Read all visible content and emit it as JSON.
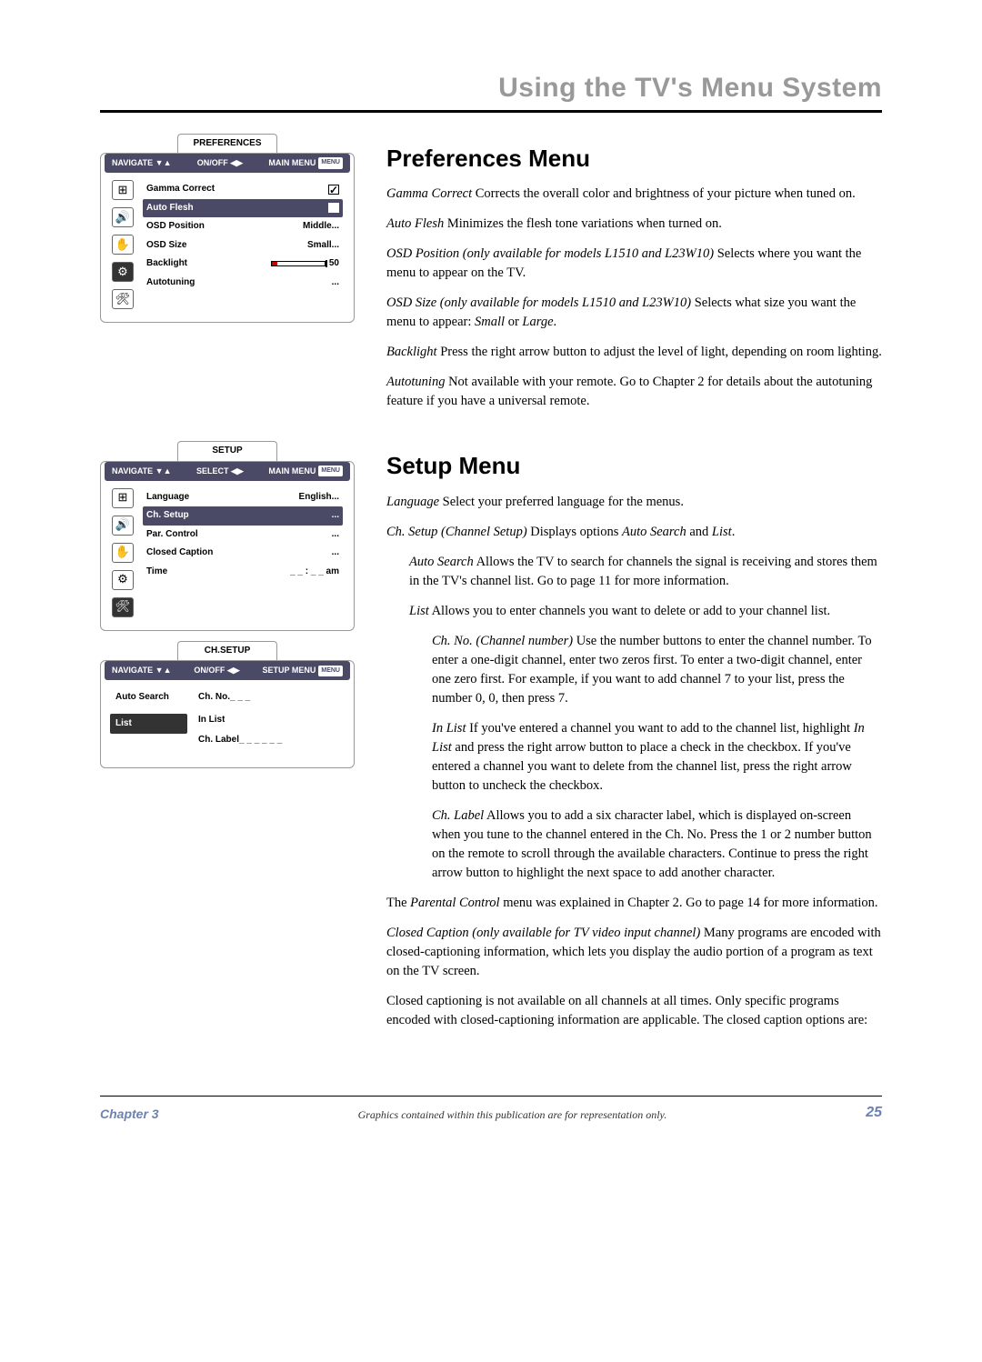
{
  "section_title": "Using the TV's Menu System",
  "preferences_menu": {
    "title_tab": "PREFERENCES",
    "nav_navigate": "NAVIGATE ▼▲",
    "nav_onoff": "ON/OFF ◀▶",
    "nav_main": "MAIN MENU",
    "nav_badge": "MENU",
    "items": [
      {
        "label": "Gamma Correct",
        "value_type": "check",
        "hl": false
      },
      {
        "label": "Auto Flesh",
        "value_type": "check_hl",
        "hl": true
      },
      {
        "label": "OSD Position",
        "value": "Middle...",
        "hl": false
      },
      {
        "label": "OSD Size",
        "value": "Small...",
        "hl": false
      },
      {
        "label": "Backlight",
        "value_type": "slider",
        "slider_val": "50",
        "hl": false
      },
      {
        "label": "Autotuning",
        "value": "...",
        "hl": false
      }
    ]
  },
  "setup_menu": {
    "title_tab": "SETUP",
    "nav_navigate": "NAVIGATE ▼▲",
    "nav_select": "SELECT ◀▶",
    "nav_main": "MAIN MENU",
    "nav_badge": "MENU",
    "items": [
      {
        "label": "Language",
        "value": "English...",
        "hl": false
      },
      {
        "label": "Ch. Setup",
        "value": "...",
        "hl": true
      },
      {
        "label": "Par. Control",
        "value": "...",
        "hl": false
      },
      {
        "label": "Closed Caption",
        "value": "...",
        "hl": false
      },
      {
        "label": "Time",
        "value": "_ _ : _ _ am",
        "hl": false
      }
    ]
  },
  "chsetup_menu": {
    "title_tab": "CH.SETUP",
    "nav_navigate": "NAVIGATE ▼▲",
    "nav_onoff": "ON/OFF ◀▶",
    "nav_setup": "SETUP MENU",
    "nav_badge": "MENU",
    "left_items": [
      {
        "label": "Auto Search",
        "hl": false
      },
      {
        "label": "List",
        "hl": true
      }
    ],
    "right_items": [
      {
        "label": "Ch. No.",
        "value": "_ _ _",
        "hl": false
      },
      {
        "label": "In List",
        "value_type": "check_hl",
        "hl": true
      },
      {
        "label": "Ch. Label",
        "value": "_ _ _ _ _ _",
        "hl": false
      }
    ]
  },
  "text": {
    "prefs_h": "Preferences Menu",
    "gamma_l": "Gamma Correct",
    "gamma_t": "   Corrects the overall color and brightness of your picture when tuned on.",
    "aflesh_l": "Auto Flesh",
    "aflesh_t": "   Minimizes the flesh tone variations when turned on.",
    "osdpos_l": "OSD Position (only available for models L1510 and L23W10)",
    "osdpos_t": "   Selects where you want the menu to appear on the TV.",
    "osdsize_l": "OSD Size (only available for models L1510 and L23W10)",
    "osdsize_t": "   Selects what size you want the menu to appear: ",
    "osdsize_s": "Small",
    "osdsize_or": " or ",
    "osdsize_lg": "Large",
    "osdsize_dot": ".",
    "backl_l": "Backlight",
    "backl_t": "   Press the right arrow button to adjust the level of light, depending on room lighting.",
    "autot_l": "Autotuning",
    "autot_t": "   Not available with your remote. Go to Chapter 2 for details about the autotuning feature if you have a universal remote.",
    "setup_h": "Setup Menu",
    "lang_l": "Language",
    "lang_t": "   Select your preferred language for the menus.",
    "chset_l": "Ch. Setup (Channel Setup)",
    "chset_t": "   Displays options ",
    "chset_as": "Auto Search",
    "chset_and": " and ",
    "chset_list": "List",
    "chset_dot": ".",
    "as_l": "Auto Search",
    "as_t": "   Allows the TV to search for channels the signal is receiving and stores them in the TV's channel list. Go to page 11 for more information.",
    "list_l": "List",
    "list_t": "   Allows you to enter channels you want to delete or add to your channel list.",
    "chno_l": "Ch. No. (Channel number)",
    "chno_t": "   Use the number buttons to enter the channel number. To enter a one-digit channel, enter two zeros first. To enter a two-digit channel, enter one zero first. For example, if you want to add channel 7 to your list, press the number 0, 0, then press 7.",
    "inlist_l": "In List",
    "inlist_t1": "   If you've entered a channel you want to add to the channel list, highlight ",
    "inlist_il": "In List",
    "inlist_t2": " and press the right arrow button to place a check in the checkbox. If you've entered a channel you want to delete from the channel list, press the right arrow button to uncheck the checkbox.",
    "chlab_l": "Ch. Label",
    "chlab_t": "   Allows you to add a six character label, which is displayed on-screen when you tune to the channel entered in the Ch. No. Press the 1 or 2 number button on the remote to scroll through the available characters. Continue to press the right arrow button to highlight the next space to add another character.",
    "pc1": "The ",
    "pc_l": "Parental Control",
    "pc2": " menu was explained in Chapter 2. Go to page 14 for more information.",
    "cc_l": "Closed Caption (only available for TV video input channel)",
    "cc_t": "   Many programs are encoded with closed-captioning information, which lets you display the audio portion of a program as text on the TV screen.",
    "cc_p2": "Closed captioning is not available on all channels at all times. Only specific programs encoded with closed-captioning information are applicable. The closed caption options are:"
  },
  "footer": {
    "chapter": "Chapter 3",
    "disclaimer": "Graphics contained within this publication are for representation only.",
    "page": "25"
  }
}
